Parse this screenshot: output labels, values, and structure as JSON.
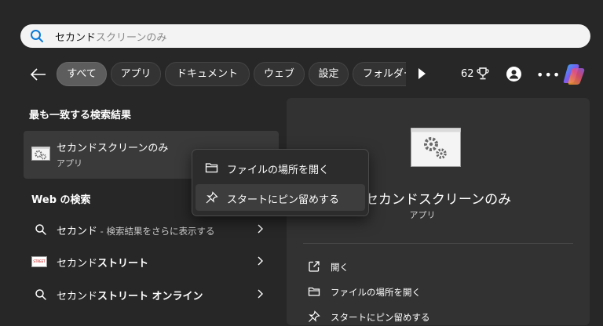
{
  "search": {
    "typed": "セカンド",
    "suggestion_rest": "スクリーンのみ",
    "icon": "search-icon"
  },
  "filters": {
    "tabs": [
      "すべて",
      "アプリ",
      "ドキュメント",
      "ウェブ",
      "設定",
      "フォルダー"
    ],
    "active_index": 0,
    "points": "62"
  },
  "best_match": {
    "heading": "最も一致する検索結果",
    "name": "セカンドスクリーンのみ",
    "type": "アプリ"
  },
  "web": {
    "heading": "Web の検索",
    "items": [
      {
        "query": "セカンド",
        "suffix": " - 検索結果をさらに表示する",
        "icon": "search-icon"
      },
      {
        "query": "セカンド",
        "bold": "ストリート",
        "icon": "site-logo-icon",
        "logo_text": "STREET"
      },
      {
        "query": "セカンド",
        "bold": "ストリート オンライン",
        "icon": "search-icon"
      }
    ]
  },
  "context_menu": {
    "items": [
      "ファイルの場所を開く",
      "スタートにピン留めする"
    ]
  },
  "detail": {
    "name": "セカンドスクリーンのみ",
    "type": "アプリ",
    "actions": [
      "開く",
      "ファイルの場所を開く",
      "スタートにピン留めする"
    ]
  },
  "colors": {
    "background": "#272727",
    "panel": "#323232",
    "accent": "#0a7ad8"
  }
}
